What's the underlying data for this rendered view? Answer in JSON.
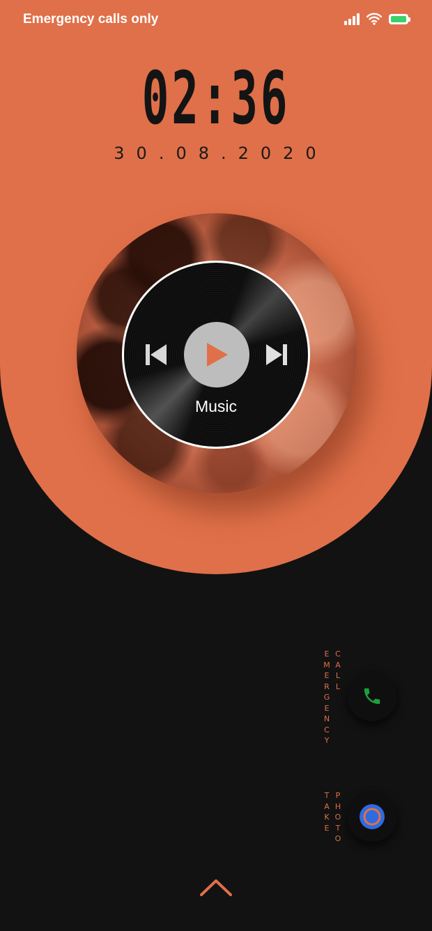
{
  "status_bar": {
    "carrier": "Emergency calls only",
    "icons": [
      "signal-icon",
      "wifi-icon",
      "battery-icon"
    ]
  },
  "lock": {
    "time": "02:36",
    "date": "30.08.2020"
  },
  "music_widget": {
    "label": "Music",
    "controls": [
      "previous-icon",
      "play-icon",
      "next-icon"
    ]
  },
  "shortcuts": {
    "emergency_word": "EMERGENCY",
    "call_word": "CALL",
    "take_word": "TAKE",
    "photo_word": "PHOTO"
  },
  "colors": {
    "accent": "#E07049",
    "background": "#121212",
    "phone_icon": "#1E9E3E",
    "camera_icon": "#2F6BE0"
  }
}
